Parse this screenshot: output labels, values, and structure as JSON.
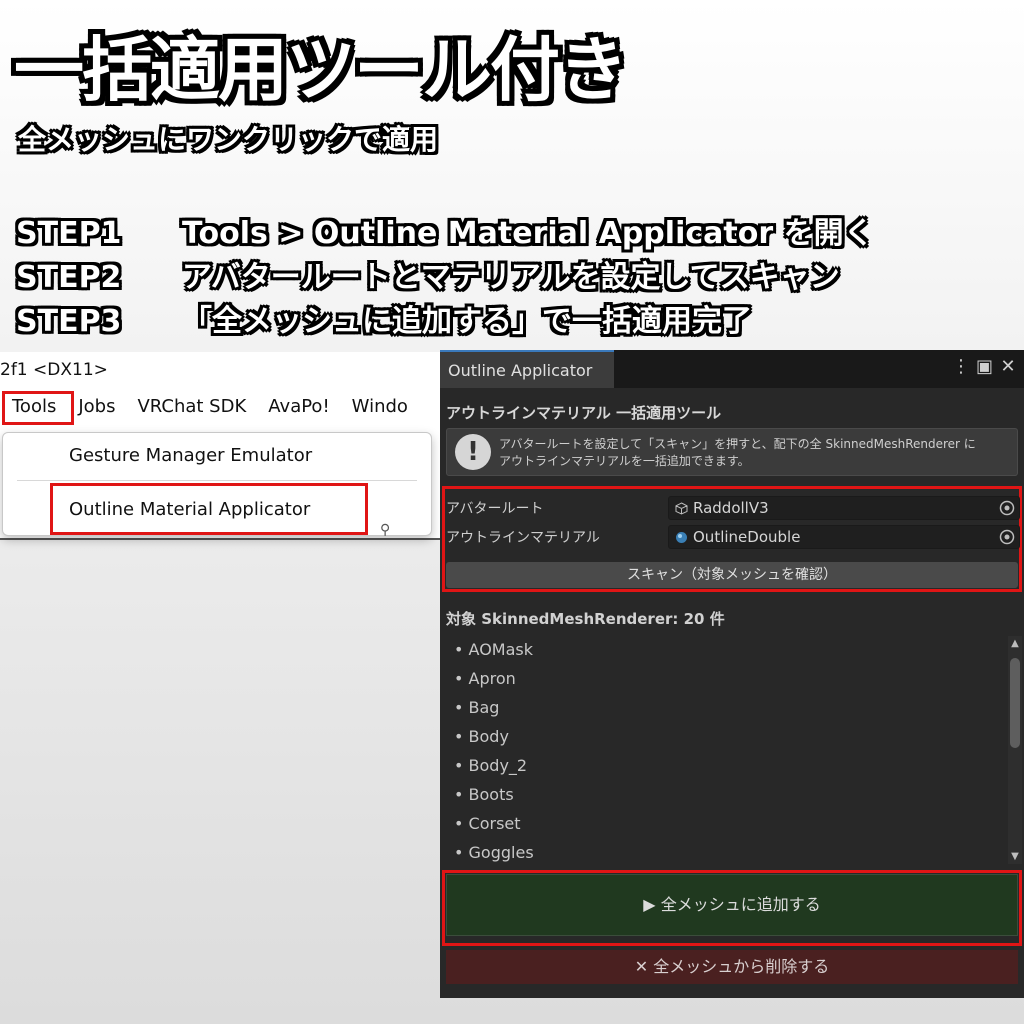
{
  "promo": {
    "headline": "一括適用ツール付き",
    "subline": "全メッシュにワンクリックで適用",
    "steps": [
      {
        "key": "STEP1",
        "text": "Tools > Outline Material Applicator を開く"
      },
      {
        "key": "STEP2",
        "text": "アバタールートとマテリアルを設定してスキャン"
      },
      {
        "key": "STEP3",
        "text": "「全メッシュに追加する」で一括適用完了"
      }
    ]
  },
  "editor_menu": {
    "window_title_fragment": "2f1 <DX11>",
    "menubar": [
      "Tools",
      "Jobs",
      "VRChat SDK",
      "AvaPo!",
      "Windo"
    ],
    "dropdown_items": [
      "Gesture Manager Emulator",
      "Outline Material Applicator"
    ],
    "highlight_color": "#e01515"
  },
  "applicator": {
    "tab_title": "Outline Applicator",
    "window_buttons": [
      "more-icon",
      "maximize-icon",
      "close-icon"
    ],
    "section_title": "アウトラインマテリアル 一括適用ツール",
    "info_line1": "アバタールートを設定して「スキャン」を押すと、配下の全 SkinnedMeshRenderer に",
    "info_line2": "アウトラインマテリアルを一括追加できます。",
    "fields": {
      "avatar_root_label": "アバタールート",
      "avatar_root_value": "RaddollV3",
      "outline_material_label": "アウトラインマテリアル",
      "outline_material_value": "OutlineDouble"
    },
    "scan_button": "スキャン（対象メッシュを確認）",
    "count_label": "対象 SkinnedMeshRenderer: 20 件",
    "list_items": [
      "• AOMask",
      "• Apron",
      "• Bag",
      "• Body",
      "• Body_2",
      "• Boots",
      "• Corset",
      "• Goggles"
    ],
    "add_button": "▶  全メッシュに追加する",
    "remove_button": "✕  全メッシュから削除する",
    "colors": {
      "panel_bg": "#282828",
      "add_bg": "#20391f",
      "remove_bg": "#4a2020",
      "accent_red": "#e01515"
    }
  }
}
